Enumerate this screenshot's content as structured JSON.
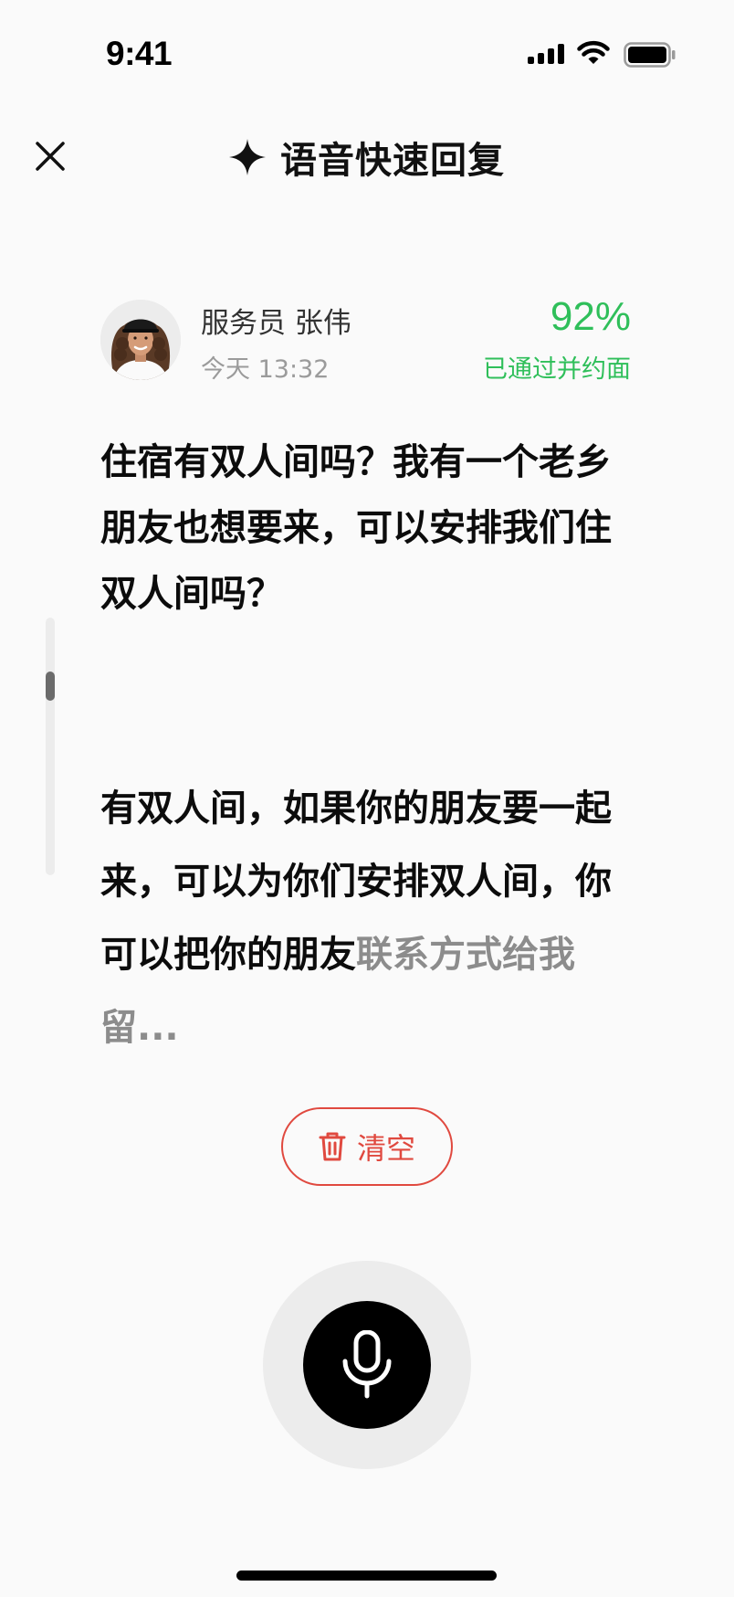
{
  "status_bar": {
    "time": "9:41"
  },
  "header": {
    "title": "语音快速回复",
    "close_icon": "close-icon",
    "title_icon": "sparkle-icon"
  },
  "speaker": {
    "name": "服务员 张伟",
    "time": "今天 13:32",
    "score": "92%",
    "score_label": "已通过并约面"
  },
  "transcript": {
    "question": "住宿有双人间吗？我有一个老乡朋友也想要来，可以安排我们住双人间吗？",
    "answer_confirmed": "有双人间，如果你的朋友要一起来，可以为你们安排双人间，你可以把你的朋友",
    "answer_pending": "联系方式给我留..."
  },
  "actions": {
    "clear_label": "清空",
    "clear_icon": "trash-icon",
    "mic_icon": "microphone-icon"
  },
  "colors": {
    "accent_green": "#2fbf5a",
    "danger_red": "#e0493f",
    "pending_gray": "#8c8c8c"
  }
}
